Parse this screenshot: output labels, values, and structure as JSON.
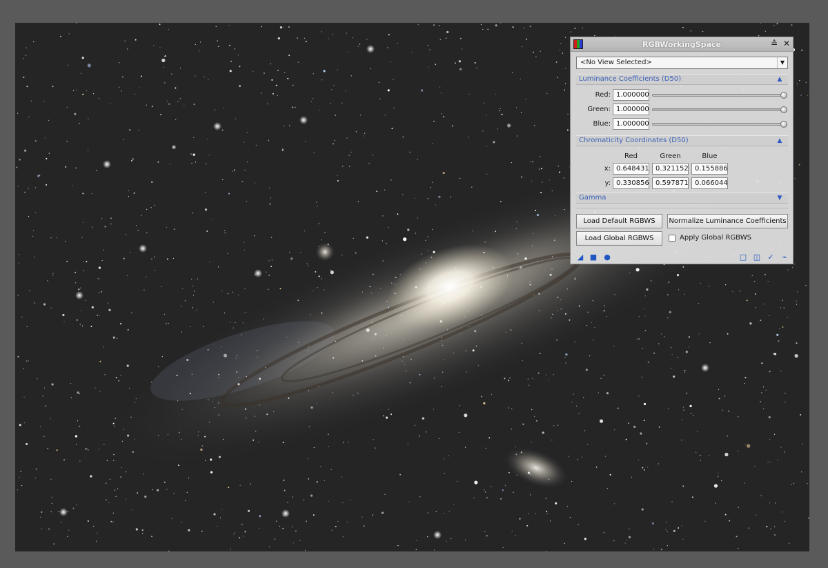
{
  "dialog": {
    "title": "RGBWorkingSpace",
    "view_select": "<No View Selected>",
    "luminance": {
      "title": "Luminance Coefficients (D50)",
      "rows": [
        {
          "label": "Red:",
          "value": "1.000000",
          "slider_fraction": 1.0
        },
        {
          "label": "Green:",
          "value": "1.000000",
          "slider_fraction": 1.0
        },
        {
          "label": "Blue:",
          "value": "1.000000",
          "slider_fraction": 1.0
        }
      ]
    },
    "chromaticity": {
      "title": "Chromaticity Coordinates (D50)",
      "columns": [
        "Red",
        "Green",
        "Blue"
      ],
      "x_label": "x:",
      "y_label": "y:",
      "x_values": [
        "0.648431",
        "0.321152",
        "0.155886"
      ],
      "y_values": [
        "0.330856",
        "0.597871",
        "0.066044"
      ]
    },
    "gamma": {
      "title": "Gamma"
    },
    "buttons": {
      "load_default": "Load Default RGBWS",
      "normalize": "Normalize Luminance Coefficients",
      "load_global": "Load Global RGBWS",
      "apply_global": "Apply Global RGBWS",
      "apply_global_checked": false
    },
    "icons": {
      "shade": "shade-icon",
      "close": "close-icon",
      "new_instance": "new-instance-icon",
      "apply_global": "apply-global-icon",
      "execute": "execute-icon",
      "browse_doc": "browse-documentation-icon",
      "preferences": "preferences-icon",
      "apply": "apply-icon",
      "reset": "reset-icon"
    }
  },
  "colors": {
    "section_text": "#3a60b8",
    "accent_icon": "#1f56c2",
    "sky": "#252526",
    "workspace": "#5a5a5a"
  }
}
